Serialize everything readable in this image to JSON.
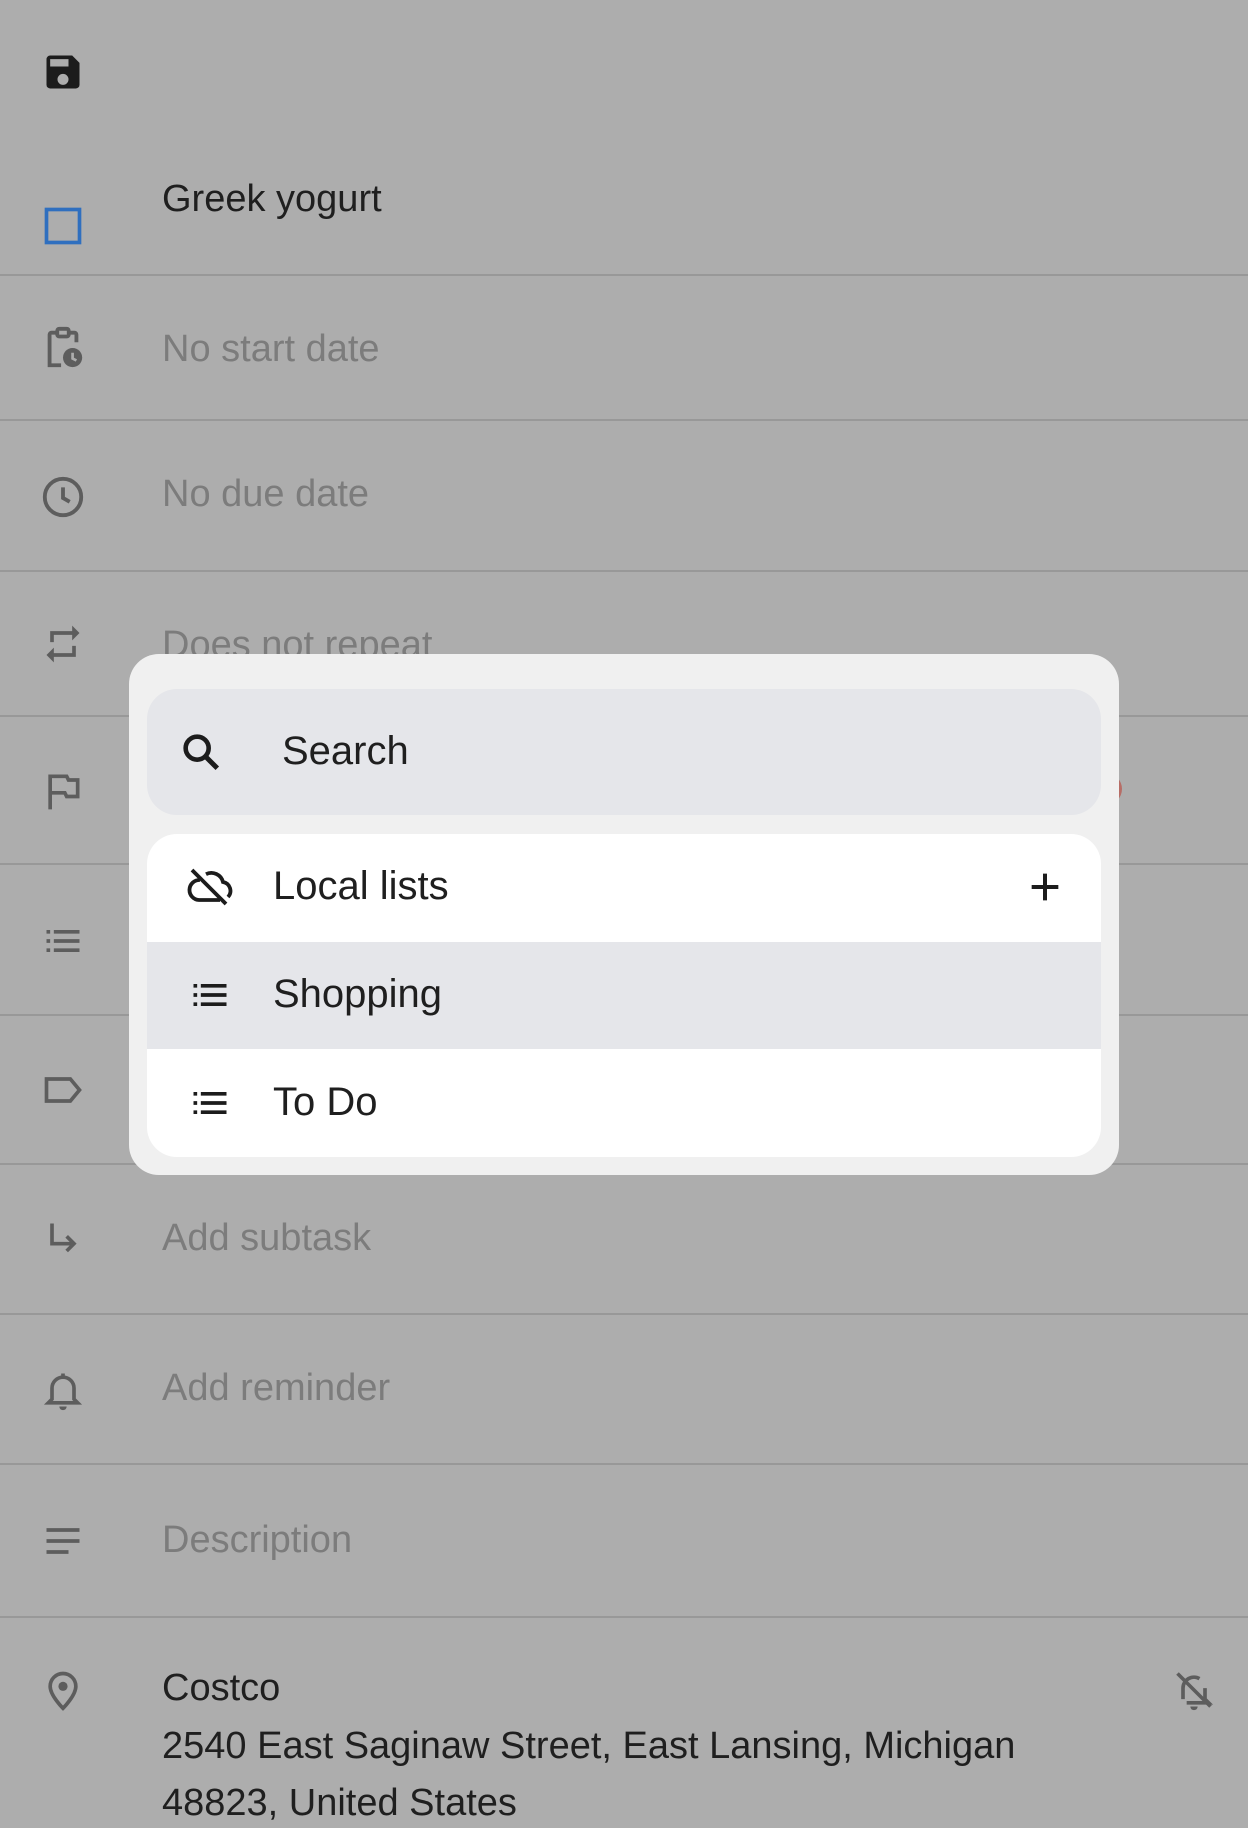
{
  "task": {
    "title": "Greek yogurt",
    "start_date": "No start date",
    "due_date": "No due date",
    "repeat": "Does not repeat",
    "subtask": "Add subtask",
    "reminder": "Add reminder",
    "description": "Description",
    "location": {
      "name": "Costco",
      "address_line1": "2540 East Saginaw Street, East Lansing, Michigan",
      "address_line2": "48823, United States"
    }
  },
  "picker": {
    "search_placeholder": "Search",
    "section_label": "Local lists",
    "lists": [
      {
        "label": "Shopping",
        "selected": true
      },
      {
        "label": "To Do",
        "selected": false
      }
    ]
  },
  "colors": {
    "scrim_background": "#adadad",
    "checkbox": "#2f6fbf",
    "selected_row": "#e5e6ea",
    "priority_dot": "#c0392b"
  },
  "icons": [
    "save-icon",
    "checkbox-icon",
    "calendar-clock-icon",
    "clock-icon",
    "repeat-icon",
    "flag-icon",
    "list-icon",
    "label-icon",
    "subtask-arrow-icon",
    "bell-icon",
    "notes-icon",
    "location-pin-icon",
    "bell-off-icon",
    "search-icon",
    "cloud-off-icon",
    "add-icon"
  ]
}
